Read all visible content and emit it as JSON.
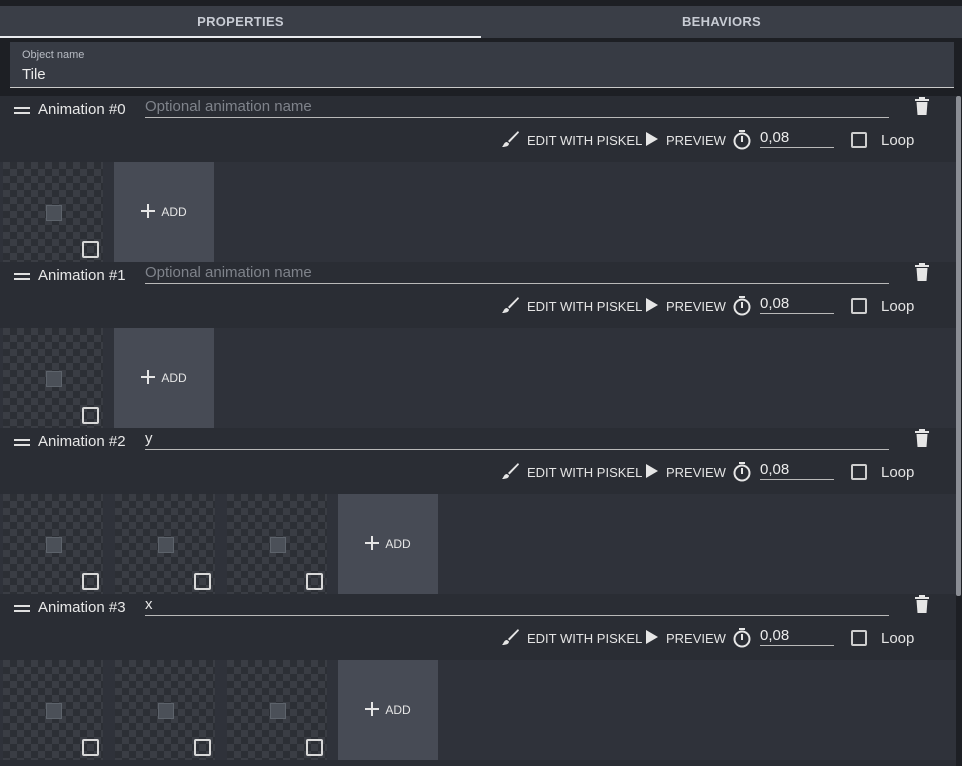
{
  "tabs": [
    {
      "label": "PROPERTIES",
      "active": true
    },
    {
      "label": "BEHAVIORS",
      "active": false
    }
  ],
  "object": {
    "label": "Object name",
    "value": "Tile"
  },
  "toolbar": {
    "edit_label": "EDIT WITH PISKEL",
    "preview_label": "PREVIEW",
    "loop_label": "Loop"
  },
  "animations": [
    {
      "title": "Animation #0",
      "name": "",
      "placeholder": "Optional animation name",
      "duration": "0,08",
      "frame_count": 1,
      "loop": false
    },
    {
      "title": "Animation #1",
      "name": "",
      "placeholder": "Optional animation name",
      "duration": "0,08",
      "frame_count": 1,
      "loop": false
    },
    {
      "title": "Animation #2",
      "name": "y",
      "placeholder": "Optional animation name",
      "duration": "0,08",
      "frame_count": 3,
      "loop": false
    },
    {
      "title": "Animation #3",
      "name": "x",
      "placeholder": "Optional animation name",
      "duration": "0,08",
      "frame_count": 3,
      "loop": false
    }
  ],
  "add_label": "ADD",
  "icons": {
    "drag": "drag-handle-icon",
    "trash": "trash-icon",
    "brush": "brush-icon",
    "play": "play-icon",
    "timer": "timer-icon",
    "plus": "plus-icon"
  },
  "colors": {
    "background": "#1d1f24",
    "header": "#2a2d34",
    "add_button": "#474b55",
    "tab_bar": "#3a3e47"
  }
}
